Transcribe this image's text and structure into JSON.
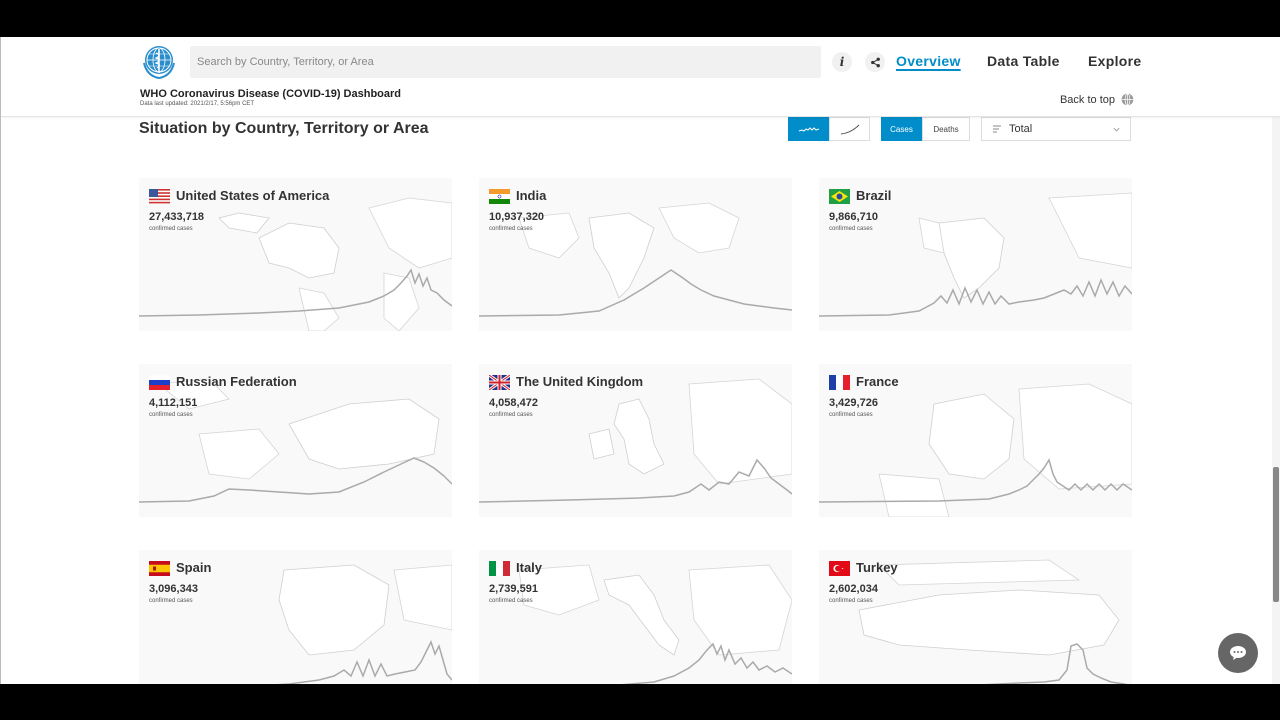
{
  "header": {
    "search_placeholder": "Search by Country, Territory, or Area",
    "info_label": "i",
    "nav": [
      {
        "label": "Overview",
        "active": true
      },
      {
        "label": "Data Table",
        "active": false
      },
      {
        "label": "Explore",
        "active": false
      }
    ],
    "dashboard_title": "WHO Coronavirus Disease (COVID-19) Dashboard",
    "last_updated": "Data last updated: 2021/2/17, 5:56pm CET",
    "back_to_top": "Back to top"
  },
  "section": {
    "title": "Situation by Country, Territory or Area",
    "metric_toggle": {
      "cases_label": "Cases",
      "deaths_label": "Deaths",
      "selected": "Cases"
    },
    "chart_toggle_selected": "daily",
    "aggregate_select": "Total"
  },
  "colors": {
    "accent": "#008dc9",
    "sparkline": "#a9a9a9"
  },
  "countries": [
    {
      "name": "United States of America",
      "cases": "27,433,718",
      "label": "confirmed cases",
      "flag": "us-flag-icon"
    },
    {
      "name": "India",
      "cases": "10,937,320",
      "label": "confirmed cases",
      "flag": "india-flag-icon"
    },
    {
      "name": "Brazil",
      "cases": "9,866,710",
      "label": "confirmed cases",
      "flag": "brazil-flag-icon"
    },
    {
      "name": "Russian Federation",
      "cases": "4,112,151",
      "label": "confirmed cases",
      "flag": "russia-flag-icon"
    },
    {
      "name": "The United Kingdom",
      "cases": "4,058,472",
      "label": "confirmed cases",
      "flag": "uk-flag-icon"
    },
    {
      "name": "France",
      "cases": "3,429,726",
      "label": "confirmed cases",
      "flag": "france-flag-icon"
    },
    {
      "name": "Spain",
      "cases": "3,096,343",
      "label": "confirmed cases",
      "flag": "spain-flag-icon"
    },
    {
      "name": "Italy",
      "cases": "2,739,591",
      "label": "confirmed cases",
      "flag": "italy-flag-icon"
    },
    {
      "name": "Turkey",
      "cases": "2,602,034",
      "label": "confirmed cases",
      "flag": "turkey-flag-icon"
    }
  ]
}
